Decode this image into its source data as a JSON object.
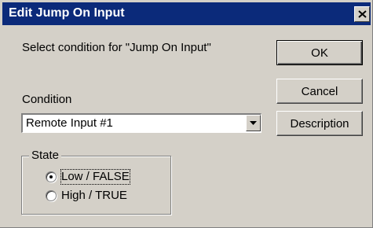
{
  "window": {
    "title": "Edit Jump On Input",
    "close_icon": "close-icon"
  },
  "prompt": "Select condition for \"Jump On Input\"",
  "condition": {
    "label": "Condition",
    "selected": "Remote Input #1",
    "dropdown_icon": "chevron-down-icon"
  },
  "state": {
    "legend": "State",
    "options": [
      {
        "label": "Low / FALSE",
        "checked": true
      },
      {
        "label": "High / TRUE",
        "checked": false
      }
    ]
  },
  "buttons": {
    "ok": "OK",
    "cancel": "Cancel",
    "description": "Description"
  },
  "colors": {
    "titlebar": "#0b2a7a",
    "face": "#d4d0c8"
  }
}
